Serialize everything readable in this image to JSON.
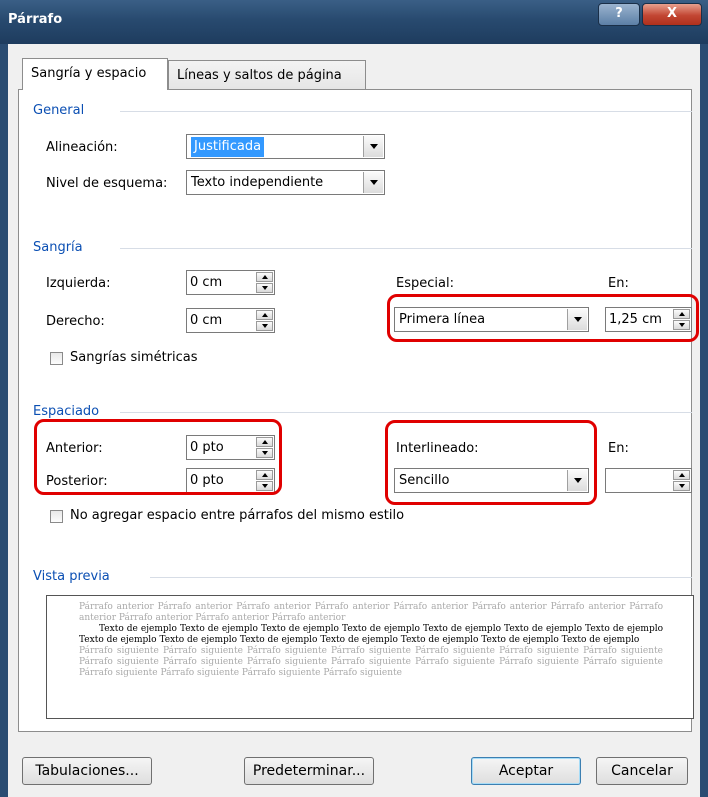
{
  "window": {
    "title": "Párrafo",
    "help_label": "?",
    "close_label": "X"
  },
  "tabs": [
    {
      "label": "Sangría y espacio",
      "active": true
    },
    {
      "label": "Líneas y saltos de página",
      "active": false
    }
  ],
  "general": {
    "group_label": "General",
    "alignment_label": "Alineación:",
    "alignment_value": "Justificada",
    "outline_label": "Nivel de esquema:",
    "outline_value": "Texto independiente"
  },
  "indent": {
    "group_label": "Sangría",
    "left_label": "Izquierda:",
    "left_value": "0 cm",
    "right_label": "Derecho:",
    "right_value": "0 cm",
    "special_label": "Especial:",
    "special_value": "Primera línea",
    "by_label": "En:",
    "by_value": "1,25 cm",
    "mirror_label": "Sangrías simétricas"
  },
  "spacing": {
    "group_label": "Espaciado",
    "before_label": "Anterior:",
    "before_value": "0 pto",
    "after_label": "Posterior:",
    "after_value": "0 pto",
    "line_label": "Interlineado:",
    "line_value": "Sencillo",
    "at_label": "En:",
    "at_value": "",
    "no_space_label": "No agregar espacio entre párrafos del mismo estilo"
  },
  "preview": {
    "group_label": "Vista previa",
    "previous_text": "Párrafo anterior Párrafo anterior Párrafo anterior Párrafo anterior Párrafo anterior Párrafo anterior Párrafo anterior Párrafo anterior Párrafo anterior Párrafo anterior Párrafo anterior",
    "sample_text": "Texto de ejemplo Texto de ejemplo Texto de ejemplo Texto de ejemplo Texto de ejemplo Texto de ejemplo Texto de ejemplo Texto de ejemplo Texto de ejemplo Texto de ejemplo Texto de ejemplo Texto de ejemplo Texto de ejemplo Texto de ejemplo",
    "next_text": "Párrafo siguiente Párrafo siguiente Párrafo siguiente Párrafo siguiente Párrafo siguiente Párrafo siguiente Párrafo siguiente Párrafo siguiente Párrafo siguiente Párrafo siguiente Párrafo siguiente Párrafo siguiente Párrafo siguiente Párrafo siguiente Párrafo siguiente Párrafo siguiente Párrafo siguiente Párrafo siguiente"
  },
  "buttons": {
    "tabs_label": "Tabulaciones...",
    "default_label": "Predeterminar...",
    "ok_label": "Aceptar",
    "cancel_label": "Cancelar"
  },
  "colors": {
    "highlight": "#e00000",
    "group_heading": "#0b4fb3",
    "selection": "#3399ff"
  }
}
